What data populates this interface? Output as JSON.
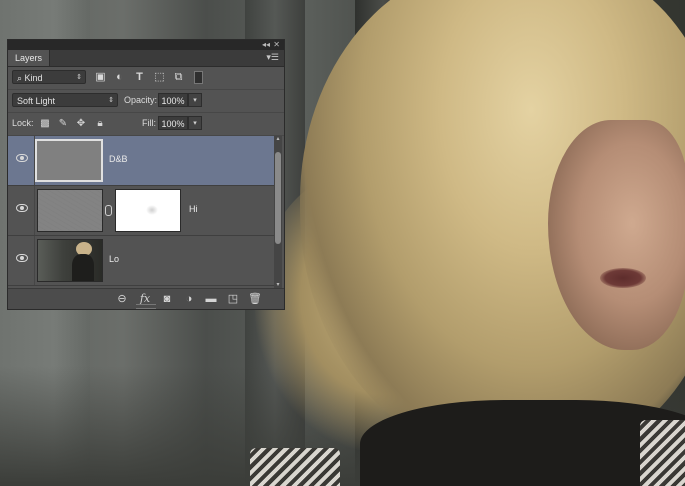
{
  "panel": {
    "tab_label": "Layers",
    "collapse_icon": "double-chevron-icon",
    "close_icon": "close-icon",
    "menu_icon": "panel-menu-icon"
  },
  "filter": {
    "kind_label": "Kind",
    "icons": [
      "search-icon",
      "pixel-filter-icon",
      "adjustment-filter-icon",
      "type-filter-icon",
      "shape-filter-icon",
      "smart-object-filter-icon",
      "filter-toggle-icon"
    ]
  },
  "blend": {
    "mode": "Soft Light",
    "opacity_label": "Opacity:",
    "opacity_value": "100%"
  },
  "lock": {
    "label": "Lock:",
    "fill_label": "Fill:",
    "fill_value": "100%"
  },
  "layers": [
    {
      "name": "D&B",
      "selected": true,
      "thumb": "gray"
    },
    {
      "name": "Hi",
      "selected": false,
      "thumb": "high-pass",
      "has_mask": true
    },
    {
      "name": "Lo",
      "selected": false,
      "thumb": "photo"
    }
  ],
  "bottom_icons": [
    "link-icon",
    "fx-icon",
    "mask-icon",
    "adjustment-icon",
    "folder-icon",
    "new-layer-icon",
    "trash-icon"
  ],
  "fx_label": "fx"
}
